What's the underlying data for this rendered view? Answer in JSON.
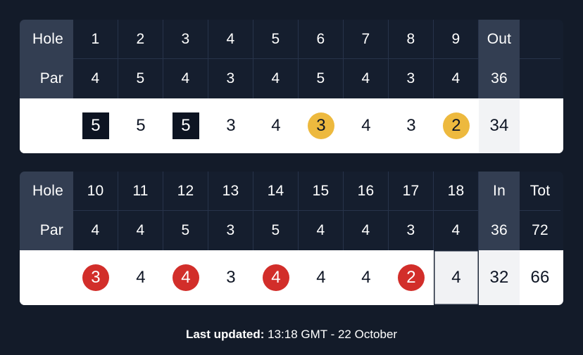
{
  "background_color": "#131b29",
  "colors": {
    "bogey_square": "#0d1422",
    "birdie_gold": "#edb93e",
    "birdie_red": "#d22e2a",
    "header_cell": "#151e2e",
    "label_column": "#333e52",
    "aggregate_column_light": "#f2f3f5"
  },
  "front_nine": {
    "hole_label": "Hole",
    "par_label": "Par",
    "holes": [
      "1",
      "2",
      "3",
      "4",
      "5",
      "6",
      "7",
      "8",
      "9"
    ],
    "aggregate_header": "Out",
    "pars": [
      "4",
      "5",
      "4",
      "3",
      "4",
      "5",
      "4",
      "3",
      "4"
    ],
    "aggregate_par": "36",
    "scores": [
      {
        "value": "5",
        "style": "bogey"
      },
      {
        "value": "5",
        "style": "plain"
      },
      {
        "value": "5",
        "style": "bogey"
      },
      {
        "value": "3",
        "style": "plain"
      },
      {
        "value": "4",
        "style": "plain"
      },
      {
        "value": "3",
        "style": "birdie-gold"
      },
      {
        "value": "4",
        "style": "plain"
      },
      {
        "value": "3",
        "style": "plain"
      },
      {
        "value": "2",
        "style": "birdie-gold"
      }
    ],
    "aggregate_score": "34"
  },
  "back_nine": {
    "hole_label": "Hole",
    "par_label": "Par",
    "holes": [
      "10",
      "11",
      "12",
      "13",
      "14",
      "15",
      "16",
      "17",
      "18"
    ],
    "aggregate_header": "In",
    "total_header": "Tot",
    "pars": [
      "4",
      "4",
      "5",
      "3",
      "5",
      "4",
      "4",
      "3",
      "4"
    ],
    "aggregate_par": "36",
    "total_par": "72",
    "scores": [
      {
        "value": "3",
        "style": "birdie-red"
      },
      {
        "value": "4",
        "style": "plain"
      },
      {
        "value": "4",
        "style": "birdie-red"
      },
      {
        "value": "3",
        "style": "plain"
      },
      {
        "value": "4",
        "style": "birdie-red"
      },
      {
        "value": "4",
        "style": "plain"
      },
      {
        "value": "4",
        "style": "plain"
      },
      {
        "value": "2",
        "style": "birdie-red"
      },
      {
        "value": "4",
        "style": "plain",
        "current": true
      }
    ],
    "aggregate_score": "32",
    "total_score": "66"
  },
  "footer": {
    "label": "Last updated:",
    "value": "13:18 GMT - 22 October"
  }
}
